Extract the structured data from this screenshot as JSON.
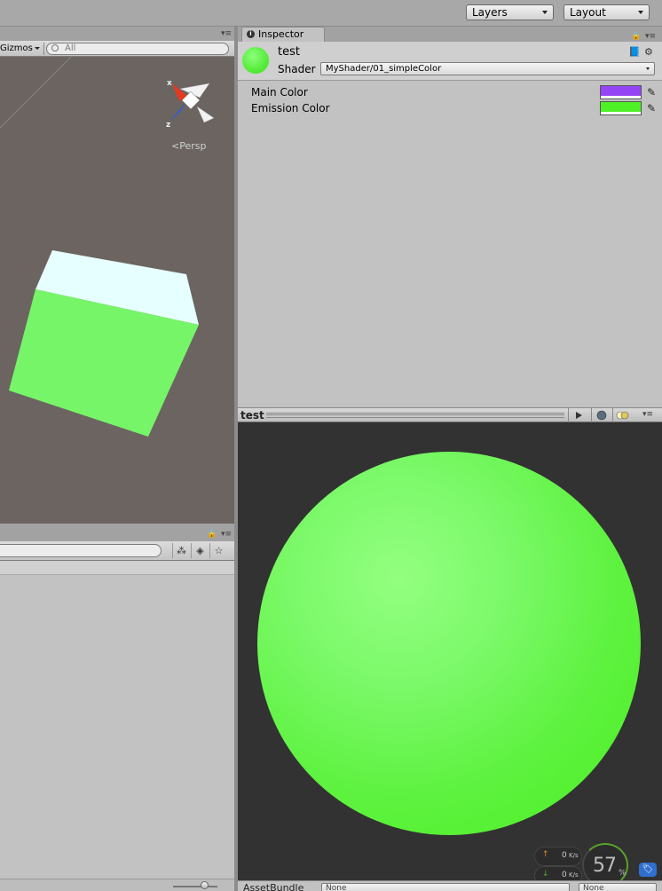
{
  "toolbar": {
    "layers_label": "Layers",
    "layout_label": "Layout"
  },
  "scene": {
    "gizmos_label": "Gizmos",
    "search_placeholder": "All",
    "projection_label": "Persp",
    "axis_labels": {
      "x": "x",
      "z": "z"
    },
    "cube_colors": {
      "top": "#e6ffff",
      "front": "#76f568",
      "background": "#6b6460"
    }
  },
  "inspector": {
    "tab_label": "Inspector",
    "material_name": "test",
    "shader_label": "Shader",
    "shader_value": "MyShader/01_simpleColor",
    "properties": [
      {
        "label": "Main Color",
        "color": "#9545f5"
      },
      {
        "label": "Emission Color",
        "color": "#4ef125"
      }
    ]
  },
  "preview": {
    "title": "test",
    "sphere_color": "#5ef240",
    "background": "#323232"
  },
  "stats": {
    "upload": "0",
    "download": "0",
    "unit": "K/s",
    "cpu_percent": "57",
    "percent_sign": "%"
  },
  "asset_bundle": {
    "label": "AssetBundle",
    "value": "None",
    "variant": "None"
  }
}
